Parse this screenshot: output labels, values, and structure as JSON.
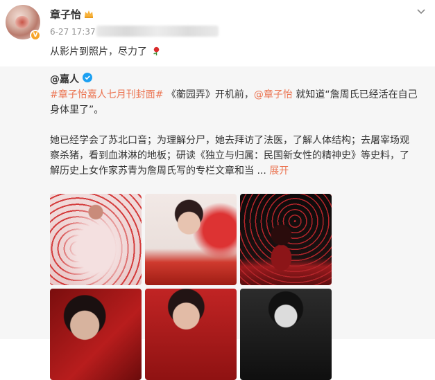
{
  "post": {
    "author": "章子怡",
    "time": "6-27 17:37",
    "text": "从影片到照片，尽力了",
    "icons": {
      "author_badge": "crown-icon",
      "menu": "chevron-down-icon",
      "emoji": "rose-icon"
    }
  },
  "repost": {
    "author": "@嘉人",
    "hashtag": "#章子怡嘉人七月刊封面#",
    "p1_seg1": " 《蘅园弄》开机前，",
    "mention": "@章子怡",
    "p1_seg2": " 就知道“詹周氏已经活在自己身体里了”。",
    "p2": "她已经学会了苏北口音；为理解分尸，她去拜访了法医，了解人体结构；去屠宰场观察杀猪，看到血淋淋的地板；研读《独立与归属：民国新女性的精神史》等史料，了解历史上女作家苏青为詹周氏写的专栏文章和当 ...",
    "more": "展开"
  },
  "colors": {
    "link": "#eb7350",
    "badge_orange": "#f7a52b",
    "badge_blue": "#1da1f2",
    "repost_bg": "#f6f6f6"
  }
}
